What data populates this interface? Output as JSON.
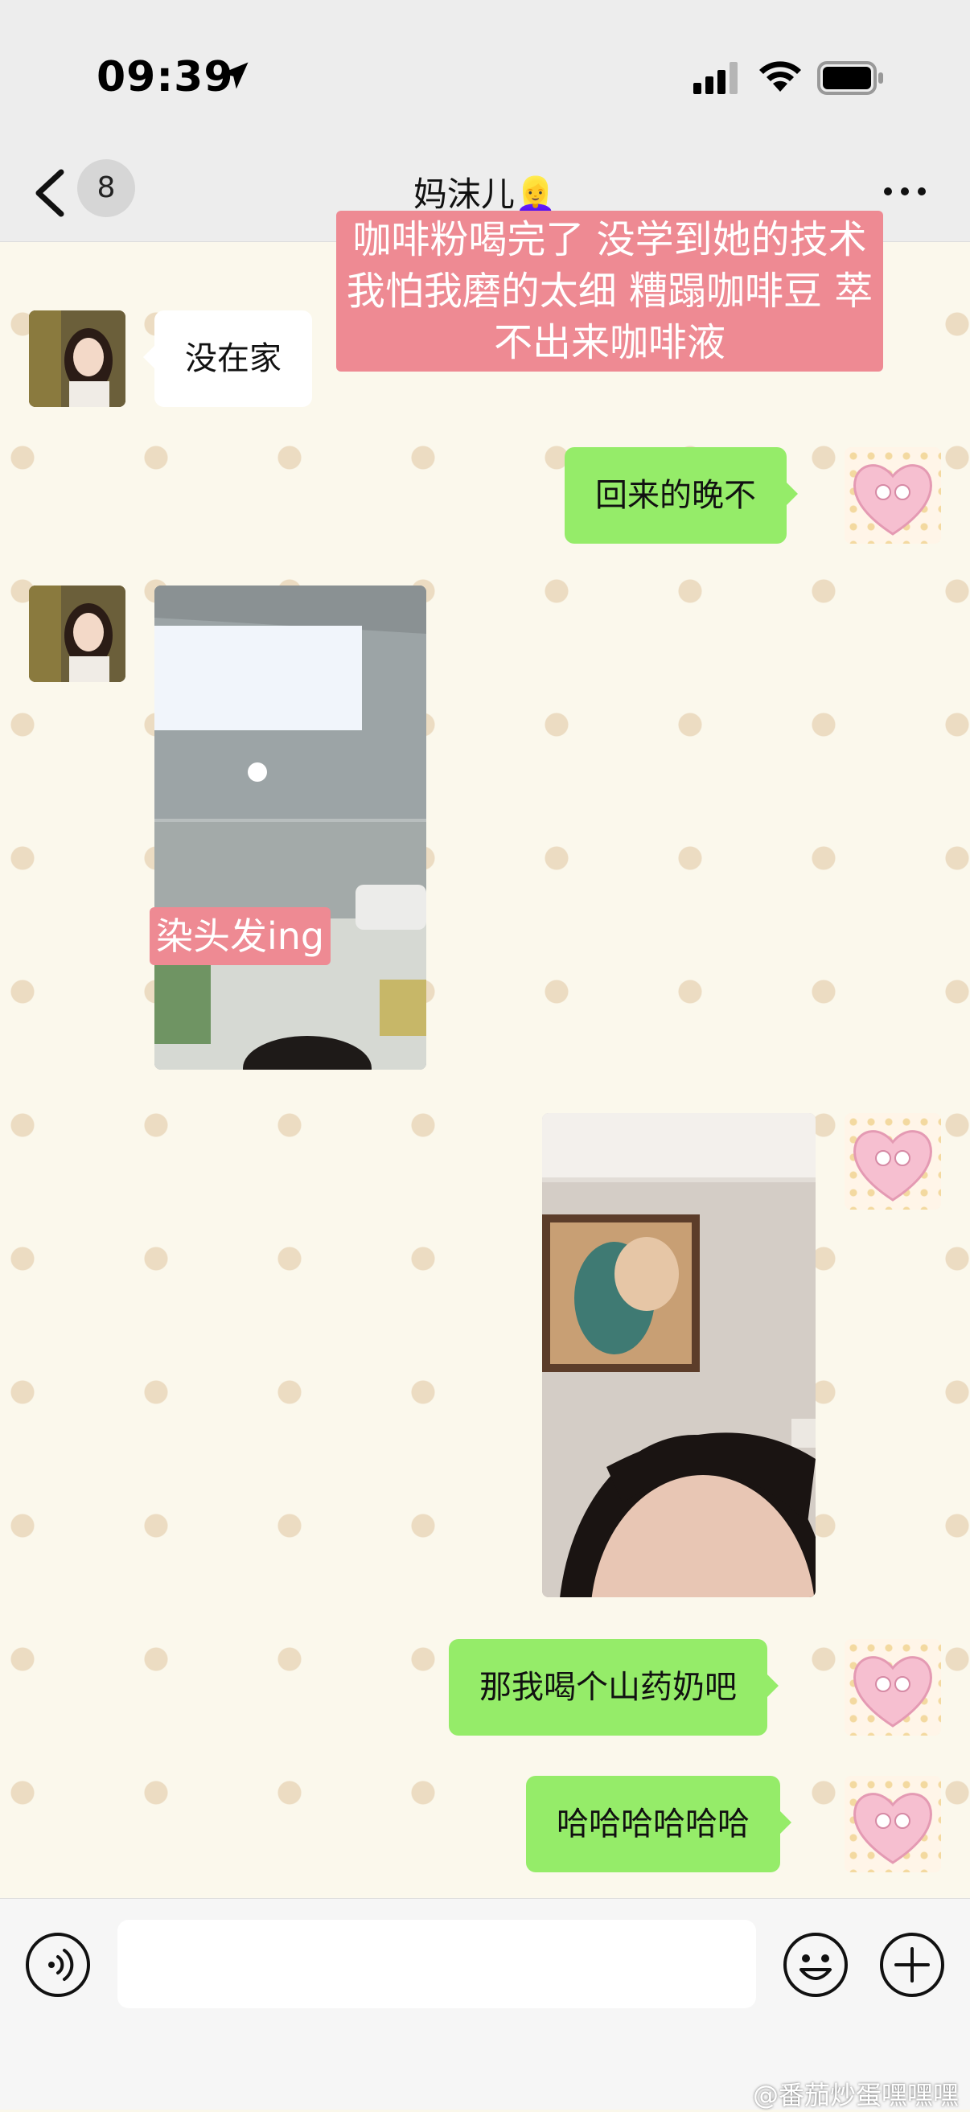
{
  "status_bar": {
    "time": "09:39"
  },
  "header": {
    "unread_count": "8",
    "title": "妈沫儿👱‍♀️"
  },
  "overlay_caption_top": "咖啡粉喝完了 没学到她的技术 我怕我磨的太细 糟蹋咖啡豆 萃不出来咖啡液",
  "messages": [
    {
      "side": "in",
      "type": "text",
      "text": "没在家"
    },
    {
      "side": "out",
      "type": "text",
      "text": "回来的晚不"
    },
    {
      "side": "in",
      "type": "image",
      "caption": "染头发ing"
    },
    {
      "side": "out",
      "type": "image"
    },
    {
      "side": "out",
      "type": "text",
      "text": "那我喝个山药奶吧"
    },
    {
      "side": "out",
      "type": "text",
      "text": "哈哈哈哈哈哈"
    }
  ],
  "input_bar": {
    "value": ""
  },
  "icons": [
    "location-arrow-icon",
    "signal-icon",
    "wifi-icon",
    "battery-icon",
    "back-chevron-icon",
    "more-icon",
    "voice-icon",
    "emoji-icon",
    "plus-icon"
  ],
  "watermark": "@番茄炒蛋嘿嘿嘿",
  "colors": {
    "outgoing_bubble": "#95ec69",
    "incoming_bubble": "#ffffff",
    "caption_bg": "#ee8a93"
  }
}
